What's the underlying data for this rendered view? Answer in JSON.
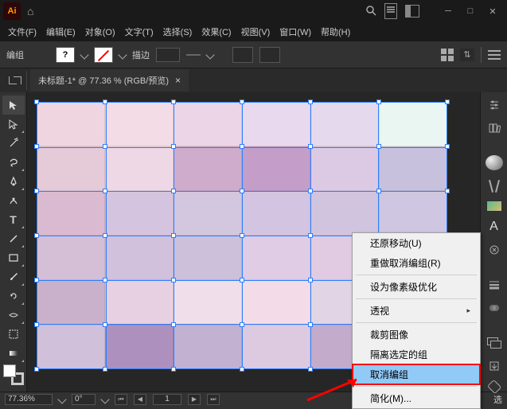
{
  "titlebar": {
    "logo": "Ai"
  },
  "menu": {
    "file": "文件(F)",
    "edit": "编辑(E)",
    "object": "对象(O)",
    "type": "文字(T)",
    "select": "选择(S)",
    "effect": "效果(C)",
    "view": "视图(V)",
    "window": "窗口(W)",
    "help": "帮助(H)"
  },
  "optbar": {
    "label": "编组",
    "stroke_label": "描边",
    "stroke_value": ""
  },
  "tab": {
    "title": "未标题-1* @ 77.36 % (RGB/预览)",
    "close": "×"
  },
  "grid_colors": [
    [
      "#efd5e0",
      "#f3dce6",
      "#ebd5e6",
      "#e8d9ef",
      "#e5d9ee",
      "#eaf6f2"
    ],
    [
      "#e5cad8",
      "#eed8e5",
      "#cfaccc",
      "#c49ec8",
      "#dccae4",
      "#c8c1dd"
    ],
    [
      "#d9bad1",
      "#d4c4df",
      "#d3c6df",
      "#d3c4e1",
      "#d0c4df",
      "#cfc6e1"
    ],
    [
      "#d5bfd6",
      "#d1c1dc",
      "#ccc0da",
      "#e0cce4",
      "#e1cbe3",
      "#bdb4d5"
    ],
    [
      "#cab1cb",
      "#e6d0e1",
      "#f0dfea",
      "#f3dce8",
      "#e1d5e5",
      "#e6d4e5"
    ],
    [
      "#d0c0d9",
      "#ad90bd",
      "#c3b1d1",
      "#ddcae1",
      "#c3abcb",
      "#d5cee2"
    ]
  ],
  "status": {
    "zoom": "77.36%",
    "rotation": "0°",
    "page": "1",
    "select_label": "选"
  },
  "ctx": {
    "undo": "还原移动(U)",
    "redo": "重做取消编组(R)",
    "pixel": "设为像素级优化",
    "perspective": "透视",
    "crop": "裁剪图像",
    "isolate": "隔离选定的组",
    "ungroup": "取消编组",
    "simplify": "简化(M)..."
  },
  "rlabels": {
    "A": "A"
  }
}
